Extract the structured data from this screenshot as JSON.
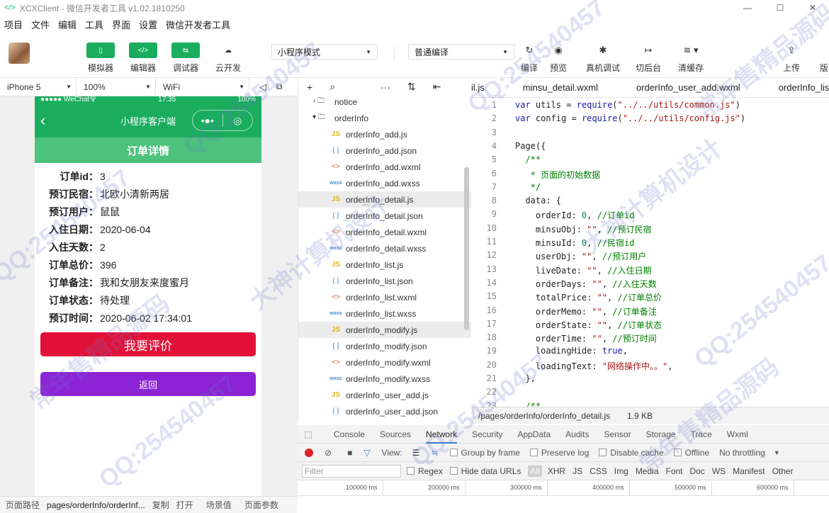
{
  "window": {
    "title": "XCXClient - 微信开发者工具 v1.02.1810250"
  },
  "menu": [
    "项目",
    "文件",
    "编辑",
    "工具",
    "界面",
    "设置",
    "微信开发者工具"
  ],
  "toolbar": {
    "simulator": "模拟器",
    "editor": "编辑器",
    "debugger": "调试器",
    "cloud": "云开发",
    "mode": "小程序模式",
    "compile_mode": "普通编译",
    "compile": "编译",
    "preview": "预览",
    "real_debug": "真机调试",
    "background": "切后台",
    "clear_cache": "清缓存",
    "upload": "上传",
    "version": "版"
  },
  "device_bar": {
    "device": "iPhone 5",
    "zoom": "100%",
    "network": "WiFi"
  },
  "phone": {
    "status_left": "●●●●● WeChat令",
    "status_time": "17:35",
    "status_right": "100%",
    "nav_title": "小程序客户端",
    "section_title": "订单详情",
    "fields": [
      {
        "k": "订单id：",
        "v": "3"
      },
      {
        "k": "预订民宿：",
        "v": "北欧小清新两居"
      },
      {
        "k": "预订用户：",
        "v": "鼠鼠"
      },
      {
        "k": "入住日期：",
        "v": "2020-06-04"
      },
      {
        "k": "入住天数：",
        "v": "2"
      },
      {
        "k": "订单总价：",
        "v": "396"
      },
      {
        "k": "订单备注：",
        "v": "我和女朋友来度蜜月"
      },
      {
        "k": "订单状态：",
        "v": "待处理"
      },
      {
        "k": "预订时间：",
        "v": "2020-06-02 17:34:01"
      }
    ],
    "btn_evaluate": "我要评价",
    "btn_back": "返回"
  },
  "bottom": {
    "path_label": "页面路径",
    "path": "pages/orderInfo/orderInf...",
    "copy": "复制",
    "open": "打开",
    "scene": "场景值",
    "params": "页面参数"
  },
  "tree": [
    {
      "name": "notice",
      "type": "folder-closed",
      "indent": 0
    },
    {
      "name": "orderInfo",
      "type": "folder-open",
      "indent": 0
    },
    {
      "name": "orderInfo_add.js",
      "type": "js",
      "indent": 1
    },
    {
      "name": "orderInfo_add.json",
      "type": "json",
      "indent": 1
    },
    {
      "name": "orderInfo_add.wxml",
      "type": "wxml",
      "indent": 1
    },
    {
      "name": "orderInfo_add.wxss",
      "type": "wxss",
      "indent": 1
    },
    {
      "name": "orderInfo_detail.js",
      "type": "js",
      "indent": 1,
      "selected": true
    },
    {
      "name": "orderInfo_detail.json",
      "type": "json",
      "indent": 1
    },
    {
      "name": "orderInfo_detail.wxml",
      "type": "wxml",
      "indent": 1
    },
    {
      "name": "orderInfo_detail.wxss",
      "type": "wxss",
      "indent": 1
    },
    {
      "name": "orderInfo_list.js",
      "type": "js",
      "indent": 1
    },
    {
      "name": "orderInfo_list.json",
      "type": "json",
      "indent": 1
    },
    {
      "name": "orderInfo_list.wxml",
      "type": "wxml",
      "indent": 1
    },
    {
      "name": "orderInfo_list.wxss",
      "type": "wxss",
      "indent": 1
    },
    {
      "name": "orderInfo_modify.js",
      "type": "js",
      "indent": 1,
      "selected": true
    },
    {
      "name": "orderInfo_modify.json",
      "type": "json",
      "indent": 1
    },
    {
      "name": "orderInfo_modify.wxml",
      "type": "wxml",
      "indent": 1
    },
    {
      "name": "orderInfo_modify.wxss",
      "type": "wxss",
      "indent": 1
    },
    {
      "name": "orderInfo_user_add.js",
      "type": "js",
      "indent": 1
    },
    {
      "name": "orderInfo_user_add.json",
      "type": "json",
      "indent": 1
    }
  ],
  "tabs": [
    "il.js",
    "minsu_detail.wxml",
    "orderInfo_user_add.wxml",
    "orderInfo_list."
  ],
  "code": [
    {
      "n": "1",
      "t": "var utils = require(\"../../utils/common.js\")"
    },
    {
      "n": "2",
      "t": "var config = require(\"../../utils/config.js\")"
    },
    {
      "n": "3",
      "t": ""
    },
    {
      "n": "4",
      "t": "Page({"
    },
    {
      "n": "5",
      "t": "  /**"
    },
    {
      "n": "6",
      "t": "   * 页面的初始数据"
    },
    {
      "n": "7",
      "t": "   */"
    },
    {
      "n": "8",
      "t": "  data: {"
    },
    {
      "n": "9",
      "t": "    orderId: 0, //订单id"
    },
    {
      "n": "10",
      "t": "    minsuObj: \"\", //预订民宿"
    },
    {
      "n": "11",
      "t": "    minsuId: 0, //民宿id"
    },
    {
      "n": "12",
      "t": "    userObj: \"\", //预订用户"
    },
    {
      "n": "13",
      "t": "    liveDate: \"\", //入住日期"
    },
    {
      "n": "14",
      "t": "    orderDays: \"\", //入住天数"
    },
    {
      "n": "15",
      "t": "    totalPrice: \"\", //订单总价"
    },
    {
      "n": "16",
      "t": "    orderMemo: \"\", //订单备注"
    },
    {
      "n": "17",
      "t": "    orderState: \"\", //订单状态"
    },
    {
      "n": "18",
      "t": "    orderTime: \"\", //预订时间"
    },
    {
      "n": "19",
      "t": "    loadingHide: true,"
    },
    {
      "n": "20",
      "t": "    loadingText: \"网络操作中。。\","
    },
    {
      "n": "21",
      "t": "  },"
    },
    {
      "n": "22",
      "t": ""
    },
    {
      "n": "23",
      "t": "  /**"
    }
  ],
  "file_info": {
    "path": "/pages/orderInfo/orderInfo_detail.js",
    "size": "1.9 KB"
  },
  "devtools": {
    "tabs": [
      "Console",
      "Sources",
      "Network",
      "Security",
      "AppData",
      "Audits",
      "Sensor",
      "Storage",
      "Trace",
      "Wxml"
    ],
    "active_tab": "Network",
    "view": "View:",
    "group_by_frame": "Group by frame",
    "preserve_log": "Preserve log",
    "disable_cache": "Disable cache",
    "offline": "Offline",
    "throttling": "No throttling",
    "filter_placeholder": "Filter",
    "regex": "Regex",
    "hide_data_urls": "Hide data URLs",
    "all": "All",
    "types": [
      "XHR",
      "JS",
      "CSS",
      "Img",
      "Media",
      "Font",
      "Doc",
      "WS",
      "Manifest",
      "Other"
    ],
    "timeline": [
      "100000 ms",
      "200000 ms",
      "300000 ms",
      "400000 ms",
      "500000 ms",
      "600000 ms"
    ]
  },
  "watermarks": [
    "QQ:254540457",
    "大神计算机设计",
    "常年售精品源码"
  ],
  "colors": {
    "primary_green": "#1aad5e",
    "evaluate": "#e2113a",
    "back": "#8c24d6"
  }
}
